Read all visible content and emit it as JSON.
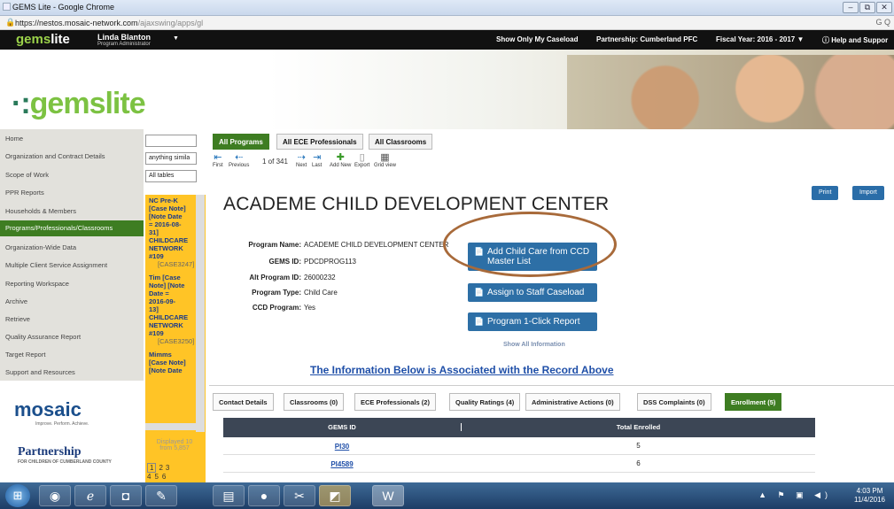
{
  "window": {
    "title": "GEMS Lite - Google Chrome",
    "min": "–",
    "max": "⧉",
    "close": "✕"
  },
  "address": {
    "host": "https://nestos.mosaic-network.com",
    "path": "/ajaxswing/apps/gl",
    "lock_icon": "🔒",
    "ext": "G Q"
  },
  "topnav": {
    "brand_a": "gems",
    "brand_b": "lite",
    "user": "Linda Blanton",
    "role": "Program Administrator",
    "caseload": "Show Only My Caseload",
    "partnership": "Partnership: Cumberland PFC",
    "fiscal": "Fiscal Year: 2016 - 2017 ▼",
    "help": "ⓘ  Help and Suppor"
  },
  "banner": {
    "logo_a": "gems",
    "logo_b": "lite"
  },
  "leftnav": [
    "Home",
    "Organization and Contract Details",
    "Scope of Work",
    "PPR Reports",
    "Households & Members",
    "Programs/Professionals/Classrooms",
    "Organization-Wide Data",
    "Multiple Client Service Assignment",
    "Reporting Workspace",
    "Archive",
    "Retrieve",
    "Quality Assurance Report",
    "Target Report",
    "Support and Resources"
  ],
  "logos": {
    "mosaic": "mosaic",
    "mosaic_tag": "Improve. Perform. Achieve.",
    "partner": "Partnership",
    "partner_tag": "FOR CHILDREN OF CUMBERLAND COUNTY"
  },
  "search": {
    "value": "",
    "mode": "anything simila",
    "scope": "All tables"
  },
  "cases": [
    {
      "lines": [
        "NC Pre-K",
        "[Case Note]",
        "[Note Date",
        "= 2016-08-",
        "31]",
        "CHILDCARE",
        "NETWORK",
        "#109"
      ],
      "tag": "[CASE3247]"
    },
    {
      "lines": [
        "Tim [Case",
        "Note] [Note",
        "Date =",
        "2016-09-",
        "13]",
        "CHILDCARE",
        "NETWORK",
        "#109"
      ],
      "tag": "[CASE3250]"
    },
    {
      "lines": [
        "Mimms",
        "[Case Note]",
        "[Note Date"
      ],
      "tag": ""
    }
  ],
  "pager": {
    "displayed": "Displayed 10",
    "from": "from 5,857",
    "p1": "1",
    "p2": "2",
    "p3": "3",
    "p4": "4",
    "p5": "5",
    "p6": "6"
  },
  "tabs": [
    "All Programs",
    "All ECE Professionals",
    "All Classrooms"
  ],
  "toolbar": {
    "first": "First",
    "previous": "Previous",
    "count": "1 of 341",
    "next": "Next",
    "last": "Last",
    "add": "Add New",
    "export": "Export",
    "grid": "Grid view"
  },
  "program": {
    "title": "ACADEME CHILD DEVELOPMENT CENTER",
    "print": "Print",
    "import": "Import",
    "fields": [
      {
        "label": "Program Name:",
        "value": "ACADEME CHILD DEVELOPMENT CENTER"
      },
      {
        "label": "GEMS ID:",
        "value": "PDCDPROG113"
      },
      {
        "label": "Alt Program ID:",
        "value": "26000232"
      },
      {
        "label": "Program Type:",
        "value": "Child Care"
      },
      {
        "label": "CCD Program:",
        "value": "Yes"
      }
    ]
  },
  "actions": {
    "add_child": "Add Child Care from CCD Master List",
    "assign": "Assign to Staff Caseload",
    "report": "Program 1-Click Report",
    "show_all": "Show All Information"
  },
  "assoc_heading": "The Information Below is Associated with the Record Above",
  "subtabs": [
    "Contact Details",
    "Classrooms (0)",
    "ECE Professionals (2)",
    "Quality Ratings (4)",
    "Administrative Actions (0)",
    "DSS Complaints (0)",
    "Enrollment (5)"
  ],
  "enrollment": {
    "headers": [
      "GEMS ID",
      "Total Enrolled"
    ],
    "rows": [
      {
        "id": "PI30",
        "total": "5"
      },
      {
        "id": "PI4589",
        "total": "6"
      }
    ]
  },
  "taskbar": {
    "time": "4:03 PM",
    "date": "11/4/2016",
    "tray": "▲ ⚑ ▣ ◀)"
  }
}
